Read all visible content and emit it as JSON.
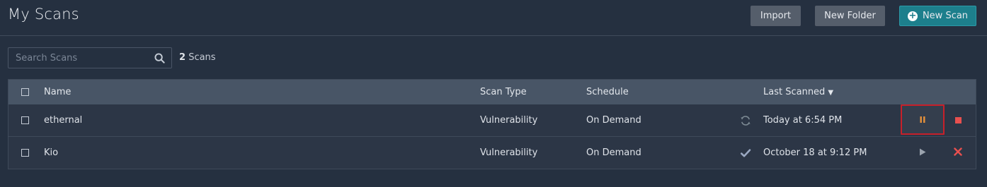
{
  "header": {
    "title": "My Scans",
    "import_label": "Import",
    "new_folder_label": "New Folder",
    "new_scan_label": "New Scan"
  },
  "search": {
    "placeholder": "Search Scans",
    "value": ""
  },
  "count": {
    "number": "2",
    "label": "Scans"
  },
  "table": {
    "columns": {
      "name": "Name",
      "scan_type": "Scan Type",
      "schedule": "Schedule",
      "last_scanned": "Last Scanned",
      "sort_indicator": "▼"
    },
    "rows": [
      {
        "name": "ethernal",
        "scan_type": "Vulnerability",
        "schedule": "On Demand",
        "status_icon": "running-refresh-icon",
        "last_scanned": "Today at 6:54 PM",
        "actions": [
          "pause-icon",
          "stop-icon"
        ]
      },
      {
        "name": "Kio",
        "scan_type": "Vulnerability",
        "schedule": "On Demand",
        "status_icon": "completed-check-icon",
        "last_scanned": "October 18 at 9:12 PM",
        "actions": [
          "play-icon",
          "delete-x-icon"
        ]
      }
    ]
  },
  "colors": {
    "background": "#253040",
    "accent": "#1d7f8c",
    "pause": "#e8923a",
    "stop": "#e8504f",
    "highlight_border": "#c8202a"
  }
}
